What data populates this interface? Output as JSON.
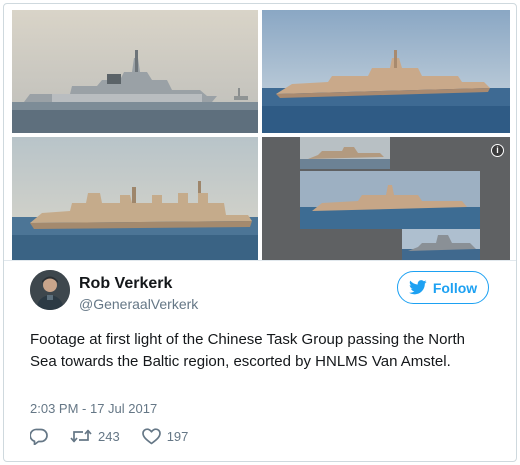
{
  "tweet": {
    "author_name": "Rob Verkerk",
    "author_handle": "@GeneraalVerkerk",
    "follow_label": "Follow",
    "text": "Footage at first light of the Chinese Task Group passing the North Sea towards the Baltic region, escorted by HNLMS Van Amstel.",
    "timestamp": "2:03 PM - 17 Jul 2017",
    "retweet_count": "243",
    "like_count": "197"
  },
  "icons": {
    "info": "info-icon",
    "follow": "twitter-bird-icon",
    "reply": "reply-icon",
    "retweet": "retweet-icon",
    "like": "heart-icon"
  },
  "colors": {
    "accent": "#1da1f2",
    "secondary_text": "#657786",
    "primary_text": "#14171a",
    "border": "#cfd9de"
  }
}
